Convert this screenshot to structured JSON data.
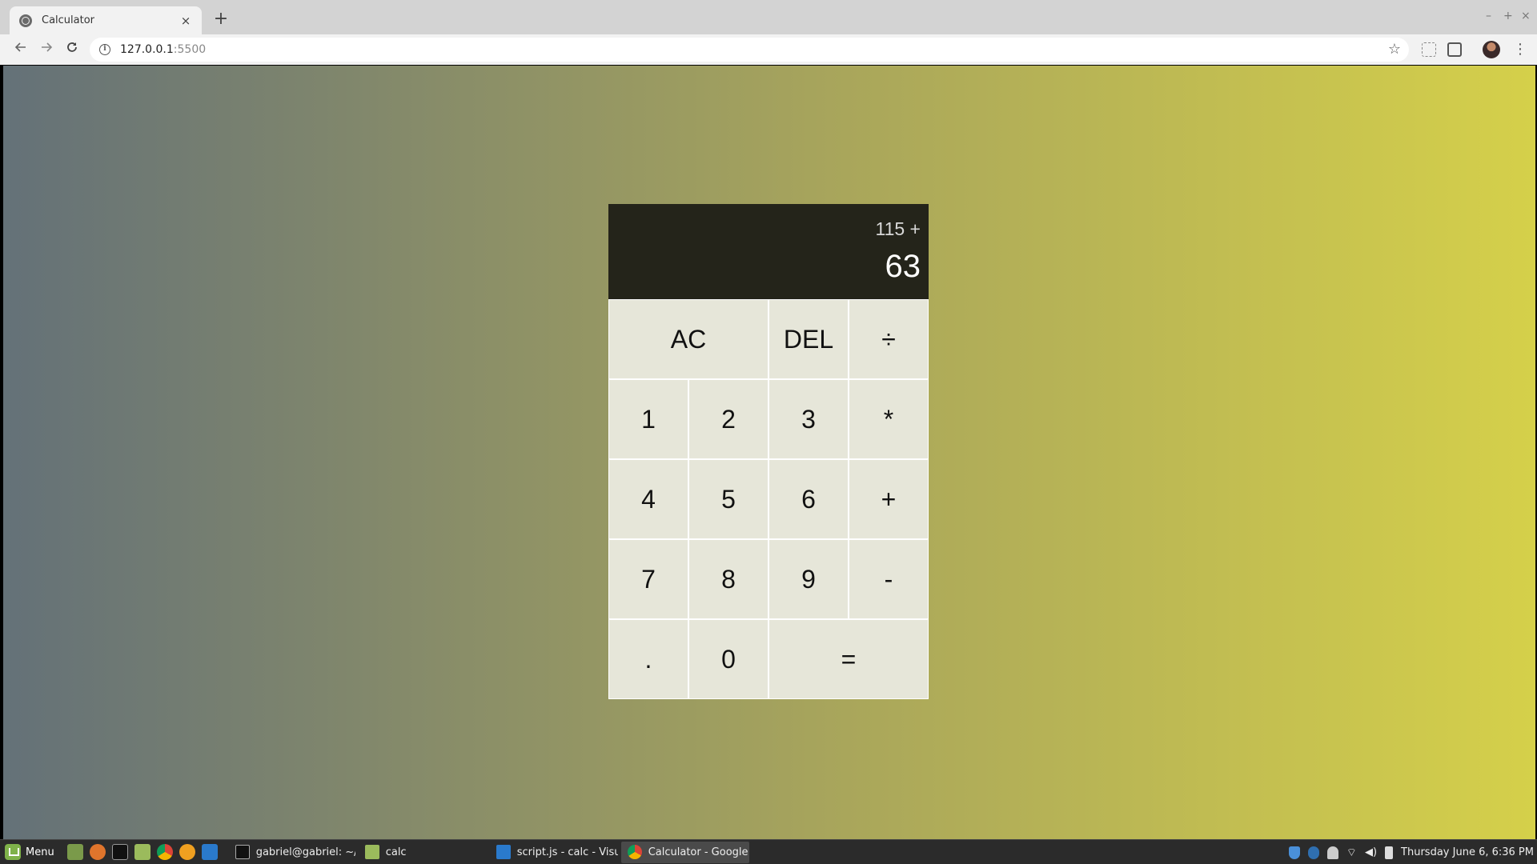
{
  "browser": {
    "tab_title": "Calculator",
    "tab_close": "×",
    "new_tab": "+",
    "url_host": "127.0.0.1",
    "url_port": ":5500",
    "window_controls": [
      "–",
      "+",
      "×"
    ]
  },
  "calculator": {
    "previous_operand": "115 +",
    "current_operand": "63",
    "keys": [
      "AC",
      "DEL",
      "÷",
      "1",
      "2",
      "3",
      "*",
      "4",
      "5",
      "6",
      "+",
      "7",
      "8",
      "9",
      "-",
      ".",
      "0",
      "="
    ]
  },
  "taskbar": {
    "menu_label": "Menu",
    "tasks": [
      {
        "label": "gabriel@gabriel: ~/..."
      },
      {
        "label": "calc"
      },
      {
        "label": "script.js - calc - Visu..."
      },
      {
        "label": "Calculator - Google ..."
      }
    ],
    "clock": "Thursday June  6,  6:36 PM"
  },
  "colors": {
    "gradient_start": "#647178",
    "gradient_end": "#d5d04a",
    "display_bg": "#24241a",
    "key_bg": "#e6e6d9"
  }
}
